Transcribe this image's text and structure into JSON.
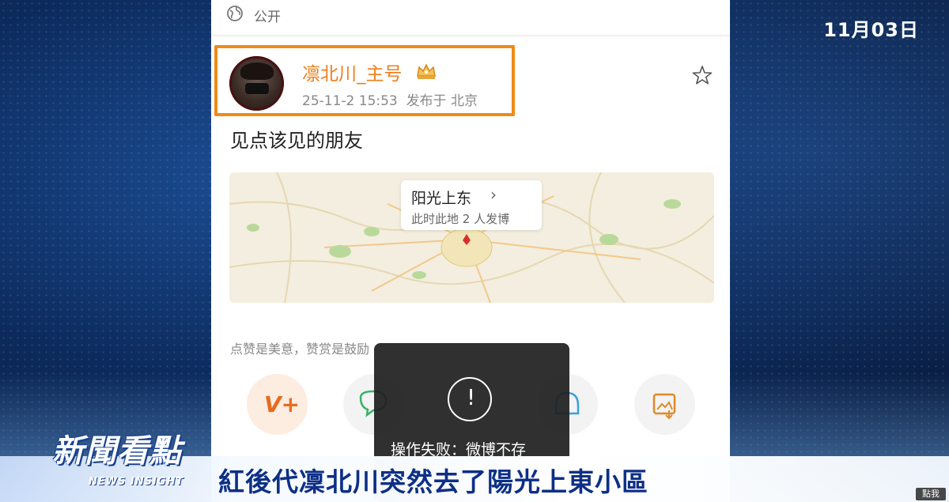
{
  "broadcast": {
    "date": "11月03日",
    "headline": "紅後代凜北川突然去了陽光上東小區",
    "logo_main": "新聞看點",
    "logo_sub": "NEWS INSIGHT",
    "corner_label": "點我"
  },
  "post": {
    "visibility": "公开",
    "username": "凛北川_主号",
    "timestamp": "25-11-2 15:53",
    "location_prefix": "发布于 北京",
    "text": "见点该见的朋友",
    "map_card": {
      "name": "阳光上东",
      "subtitle": "此时此地 2 人发博"
    },
    "tip": "点赞是美意，赞赏是鼓励"
  },
  "toast": {
    "message": "操作失败：微博不存"
  },
  "icons": {
    "globe": "globe-icon",
    "crown": "crown-badge-icon",
    "star": "star-icon",
    "pin": "map-pin-icon"
  },
  "colors": {
    "accent": "#f07d1b",
    "highlight_box": "#f08a17",
    "ribbon_text": "#0d2f86"
  }
}
